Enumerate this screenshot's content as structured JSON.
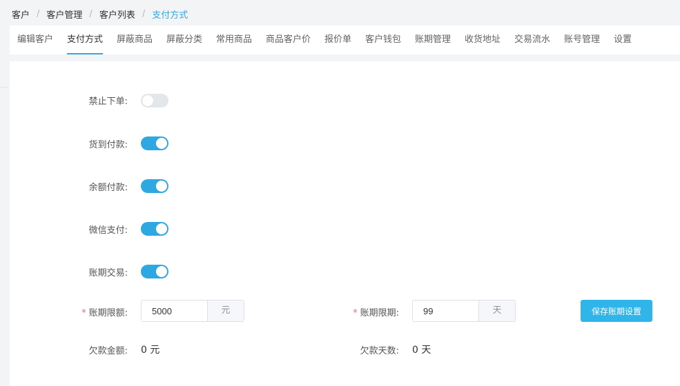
{
  "breadcrumb": {
    "items": [
      "客户",
      "客户管理",
      "客户列表"
    ],
    "current": "支付方式",
    "separator": "/"
  },
  "tabs": [
    {
      "label": "编辑客户",
      "active": false
    },
    {
      "label": "支付方式",
      "active": true
    },
    {
      "label": "屏蔽商品",
      "active": false
    },
    {
      "label": "屏蔽分类",
      "active": false
    },
    {
      "label": "常用商品",
      "active": false
    },
    {
      "label": "商品客户价",
      "active": false
    },
    {
      "label": "报价单",
      "active": false
    },
    {
      "label": "客户钱包",
      "active": false
    },
    {
      "label": "账期管理",
      "active": false
    },
    {
      "label": "收货地址",
      "active": false
    },
    {
      "label": "交易流水",
      "active": false
    },
    {
      "label": "账号管理",
      "active": false
    },
    {
      "label": "设置",
      "active": false
    }
  ],
  "switches": [
    {
      "label": "禁止下单:",
      "on": false
    },
    {
      "label": "货到付款:",
      "on": true
    },
    {
      "label": "余额付款:",
      "on": true
    },
    {
      "label": "微信支付:",
      "on": true
    },
    {
      "label": "账期交易:",
      "on": true
    }
  ],
  "credit": {
    "limit_label": "账期限额:",
    "limit_value": "5000",
    "limit_unit": "元",
    "term_label": "账期限期:",
    "term_value": "99",
    "term_unit": "天",
    "save_label": "保存账期设置",
    "required_mark": "*"
  },
  "debt": {
    "amount_label": "欠款金额:",
    "amount_value": "0 元",
    "days_label": "欠款天数:",
    "days_value": "0 天"
  },
  "colors": {
    "accent": "#2fa8e1",
    "button": "#2fb5ea",
    "required": "#f56c6c"
  }
}
